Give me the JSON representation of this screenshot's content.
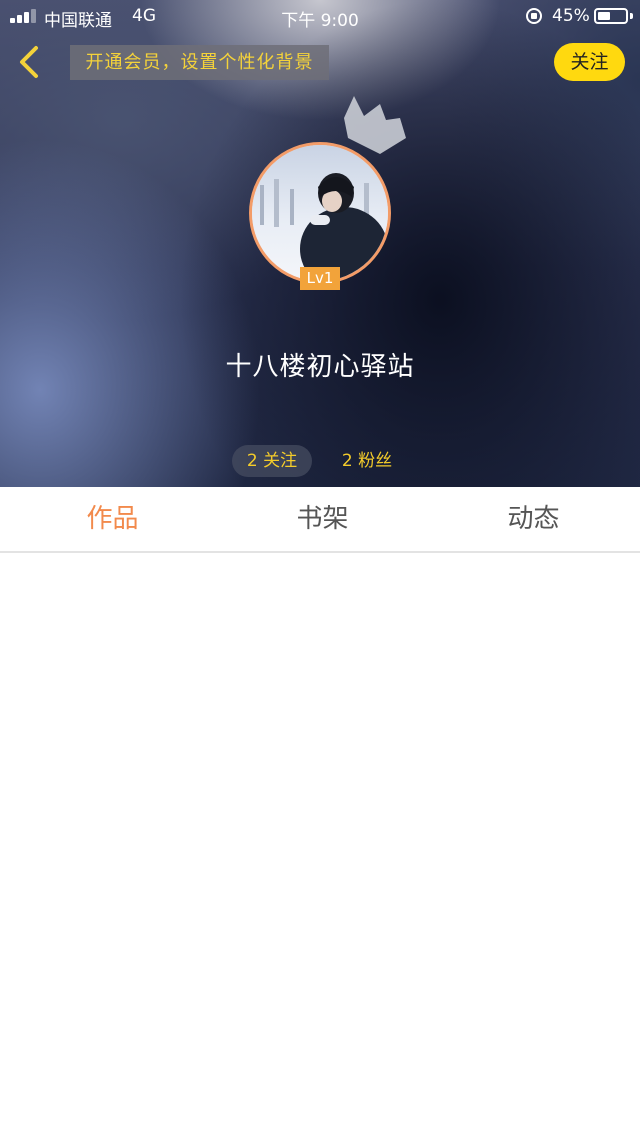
{
  "status_bar": {
    "carrier": "中国联通",
    "network": "4G",
    "time": "下午 9:00",
    "battery_percent_label": "45%",
    "battery_level": 0.45
  },
  "nav": {
    "back_icon": "chevron-left-icon",
    "vip_banner": "开通会员，设置个性化背景",
    "follow_label": "关注"
  },
  "profile": {
    "avatar_icon": "avatar-photo",
    "level": "Lv1",
    "username": "十八楼初心驿站",
    "following": "2 关注",
    "fans": "2 粉丝"
  },
  "tabs": [
    {
      "label": "作品",
      "active": true
    },
    {
      "label": "书架",
      "active": false
    },
    {
      "label": "动态",
      "active": false
    }
  ],
  "colors": {
    "accent": "#f28a4c",
    "follow_button": "#ffd90f",
    "stat_text": "#f4cc2a",
    "level_badge": "#f2a33a"
  }
}
